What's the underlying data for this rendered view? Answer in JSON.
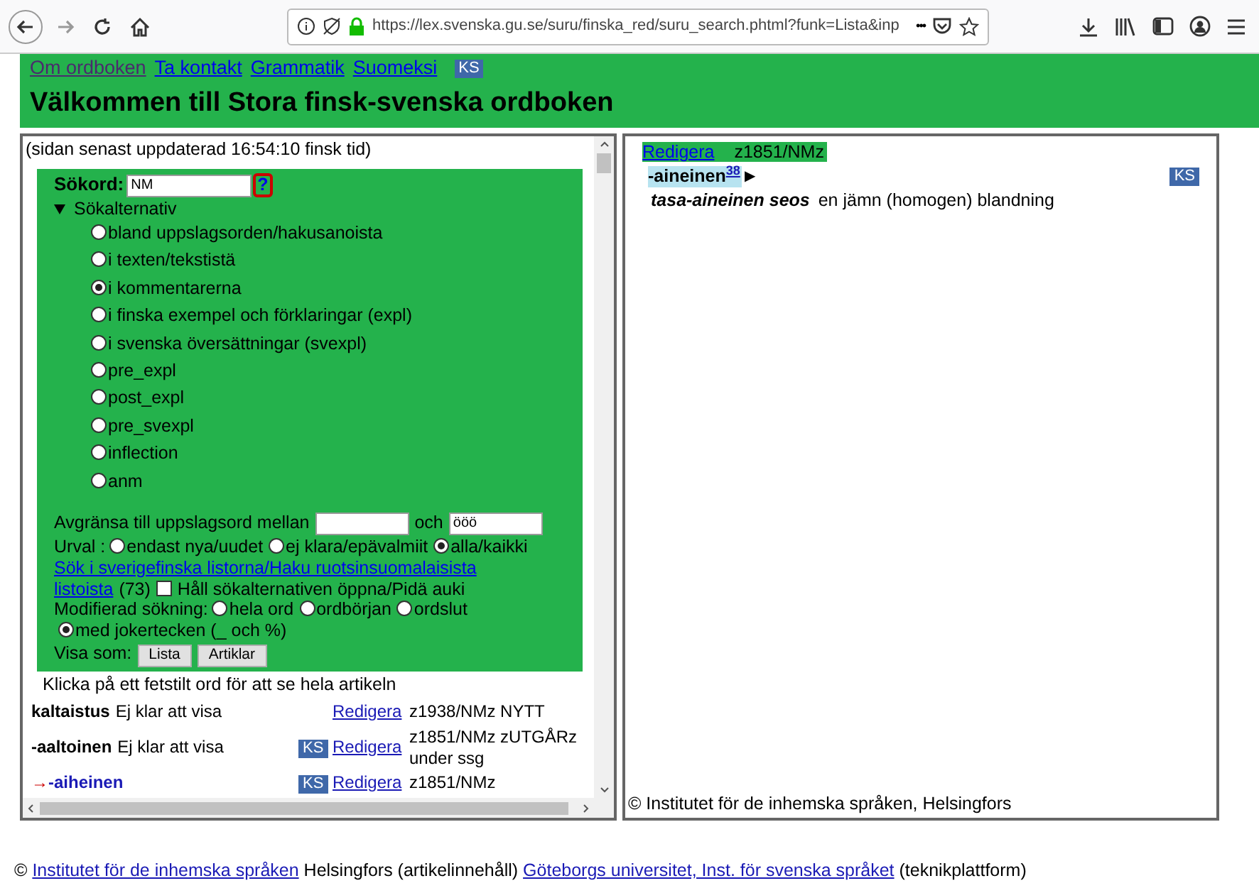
{
  "browser": {
    "url": "https://lex.svenska.gu.se/suru/finska_red/suru_search.phtml?funk=Lista&inp",
    "more": "•••"
  },
  "header": {
    "links": [
      {
        "label": "Om ordboken",
        "visited": true
      },
      {
        "label": "Ta kontakt",
        "visited": false
      },
      {
        "label": "Grammatik",
        "visited": false
      },
      {
        "label": "Suomeksi",
        "visited": false
      }
    ],
    "badge": "KS",
    "title": "Välkommen till Stora finsk-svenska ordboken"
  },
  "search_pane": {
    "updated": "(sidan senast uppdaterad 16:54:10 finsk tid)",
    "search": {
      "label": "Sökord:",
      "value": "NM",
      "help": "?"
    },
    "options_toggle": {
      "label": "Sökalternativ",
      "expanded": true
    },
    "options": [
      {
        "label": "bland uppslagsorden/hakusanoista",
        "selected": false
      },
      {
        "label": "i texten/tekstistä",
        "selected": false
      },
      {
        "label": "i kommentarerna",
        "selected": true
      },
      {
        "label": "i finska exempel och förklaringar (expl)",
        "selected": false
      },
      {
        "label": "i svenska översättningar (svexpl)",
        "selected": false
      },
      {
        "label": "pre_expl",
        "selected": false
      },
      {
        "label": "post_expl",
        "selected": false
      },
      {
        "label": "pre_svexpl",
        "selected": false
      },
      {
        "label": "inflection",
        "selected": false
      },
      {
        "label": "anm",
        "selected": false
      }
    ],
    "range": {
      "label": "Avgränsa till uppslagsord mellan",
      "and": "och",
      "to_value": "ööö"
    },
    "selection": {
      "label": "Urval :",
      "options": [
        {
          "label": "endast nya/uudet",
          "selected": false
        },
        {
          "label": "ej klara/epävalmiit",
          "selected": false
        },
        {
          "label": "alla/kaikki",
          "selected": true
        }
      ]
    },
    "list_link": [
      "Sök i sverigefinska listorna/Haku ruotsinsuomalaisista",
      "listoista"
    ],
    "list_count": "(73)",
    "keep_open": {
      "label": "Håll sökalternativen öppna/Pidä auki",
      "checked": false
    },
    "modified": {
      "label": "Modifierad sökning:",
      "options": [
        {
          "label": "hela ord",
          "selected": false
        },
        {
          "label": "ordbörjan",
          "selected": false
        },
        {
          "label": "ordslut",
          "selected": false
        },
        {
          "label": "med jokertecken (_ och %)",
          "selected": true
        }
      ]
    },
    "show_as": {
      "label": "Visa som:",
      "buttons": [
        "Lista",
        "Artiklar"
      ]
    },
    "instruction": "Klicka på ett fetstilt ord för att se hela artikeln",
    "results": [
      {
        "word": "kaltaistus",
        "status": "Ej klar att visa",
        "edit": "Redigera",
        "info": "z1938/NMz NYTT",
        "current": false
      },
      {
        "word": "-aaltoinen",
        "status": "Ej klar att visa",
        "badge": "KS",
        "edit": "Redigera",
        "info": "z1851/NMz zUTGÅRz under ssg",
        "current": false
      },
      {
        "word": "-aiheinen",
        "badge": "KS",
        "edit": "Redigera",
        "info": "z1851/NMz",
        "current": true,
        "marker": "→"
      }
    ]
  },
  "article_pane": {
    "edit": "Redigera",
    "code": "z1851/NMz",
    "headword": "-aineinen",
    "superscript": "38",
    "expand": "▶",
    "badge": "KS",
    "example": "tasa-aineinen seos",
    "translation": "en jämn (homogen) blandning",
    "copyright": "© Institutet för de inhemska språken, Helsingfors"
  },
  "footer": [
    {
      "text": "©",
      "link": false
    },
    {
      "text": "Institutet för de inhemska språken",
      "link": true
    },
    {
      "text": "Helsingfors (artikelinnehåll)",
      "link": false
    },
    {
      "text": "Göteborgs universitet, Inst. för svenska språket",
      "link": true
    },
    {
      "text": "(teknikplattform)",
      "link": false
    }
  ]
}
